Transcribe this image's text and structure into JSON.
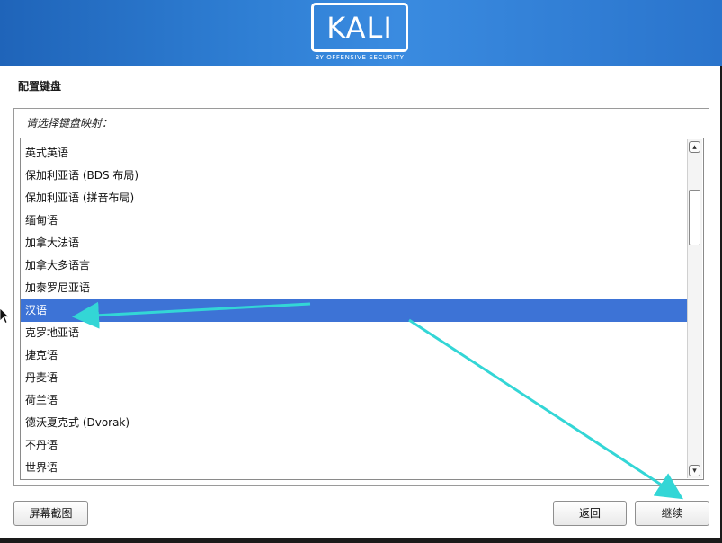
{
  "header": {
    "logo_text": "KALI",
    "logo_subtitle": "BY OFFENSIVE SECURITY"
  },
  "page_title": "配置键盘",
  "prompt": "请选择键盘映射：",
  "keymap_list": {
    "items": [
      "英式英语",
      "保加利亚语 (BDS 布局)",
      "保加利亚语 (拼音布局)",
      "缅甸语",
      "加拿大法语",
      "加拿大多语言",
      "加泰罗尼亚语",
      "汉语",
      "克罗地亚语",
      "捷克语",
      "丹麦语",
      "荷兰语",
      "德沃夏克式 (Dvorak)",
      "不丹语",
      "世界语"
    ],
    "selected": "汉语"
  },
  "buttons": {
    "screenshot": "屏幕截图",
    "back": "返回",
    "continue": "继续"
  },
  "colors": {
    "banner": "#2f7fd4",
    "selection": "#3d73d6",
    "annotation_arrow": "#33d6d6"
  }
}
